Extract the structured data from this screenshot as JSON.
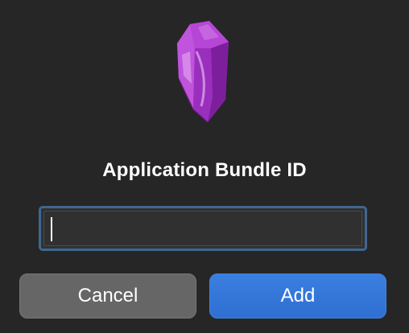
{
  "dialog": {
    "title": "Application Bundle ID",
    "icon": "purple-crystal-icon",
    "input": {
      "value": "",
      "placeholder": ""
    },
    "buttons": {
      "cancel_label": "Cancel",
      "add_label": "Add"
    }
  },
  "colors": {
    "background": "#262626",
    "accent": "#3176d9",
    "focus_ring": "#3f6790",
    "crystal": "#a338c7"
  }
}
